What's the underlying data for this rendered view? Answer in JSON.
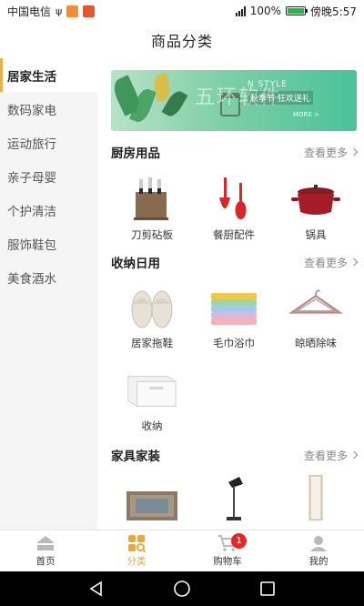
{
  "status_bar": {
    "carrier": "中国电信",
    "battery": "100%",
    "time": "傍晚5:57",
    "battery_level": 1.0
  },
  "header": {
    "title": "商品分类"
  },
  "sidebar": {
    "items": [
      {
        "label": "居家生活",
        "active": true
      },
      {
        "label": "数码家电",
        "active": false
      },
      {
        "label": "运动旅行",
        "active": false
      },
      {
        "label": "亲子母婴",
        "active": false
      },
      {
        "label": "个护清洁",
        "active": false
      },
      {
        "label": "服饰鞋包",
        "active": false
      },
      {
        "label": "美食酒水",
        "active": false
      }
    ]
  },
  "banner": {
    "main_text": "五环软件",
    "sub_text": "N STYLE",
    "tag_text": "秋季节 狂欢送礼",
    "more_text": "MORE >"
  },
  "sections": [
    {
      "title": "厨房用品",
      "more": "查看更多",
      "items": [
        {
          "label": "刀剪砧板",
          "icon": "knife-block-icon"
        },
        {
          "label": "餐厨配件",
          "icon": "spatula-icon"
        },
        {
          "label": "锅具",
          "icon": "pot-icon"
        }
      ]
    },
    {
      "title": "收纳日用",
      "more": "查看更多",
      "items": [
        {
          "label": "居家拖鞋",
          "icon": "slippers-icon"
        },
        {
          "label": "毛巾浴巾",
          "icon": "towels-icon"
        },
        {
          "label": "晾晒除味",
          "icon": "hanger-icon"
        },
        {
          "label": "收纳",
          "icon": "storage-box-icon"
        }
      ]
    },
    {
      "title": "家具家装",
      "more": "查看更多",
      "items": [
        {
          "label": "",
          "icon": "rug-icon"
        },
        {
          "label": "",
          "icon": "lamp-icon"
        },
        {
          "label": "",
          "icon": "mirror-icon"
        }
      ]
    }
  ],
  "tabbar": {
    "tabs": [
      {
        "label": "首页",
        "icon": "home-icon",
        "active": false
      },
      {
        "label": "分类",
        "icon": "category-icon",
        "active": true
      },
      {
        "label": "购物车",
        "icon": "cart-icon",
        "active": false,
        "badge": "1"
      },
      {
        "label": "我的",
        "icon": "user-icon",
        "active": false
      }
    ]
  },
  "colors": {
    "accent": "#e8a83a",
    "badge": "#e6262b",
    "sidebar_bg": "#f5f5f5"
  }
}
